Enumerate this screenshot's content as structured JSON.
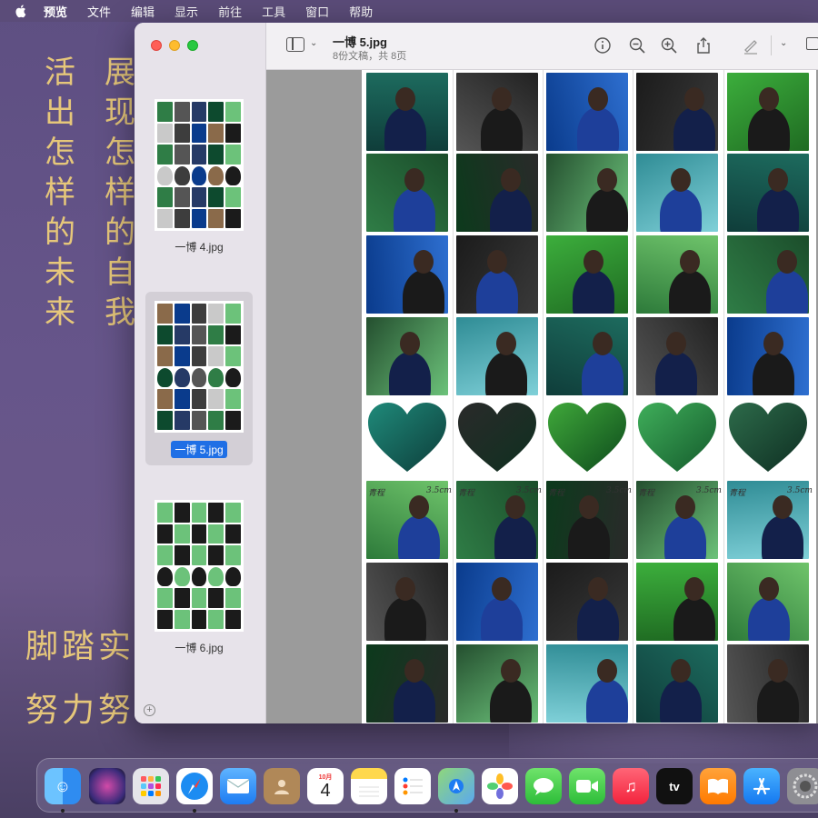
{
  "menubar": {
    "app_name": "预览",
    "items": [
      "文件",
      "编辑",
      "显示",
      "前往",
      "工具",
      "窗口",
      "帮助"
    ]
  },
  "wallpaper": {
    "col1": "活出怎样的未来",
    "col2": "展现怎样的自我",
    "line1": "脚踏实",
    "line2": "努力努"
  },
  "window": {
    "title": "一博 5.jpg",
    "subtitle": "8份文稿，共 8页",
    "thumbnails": [
      {
        "label": "一博 4.jpg",
        "selected": false
      },
      {
        "label": "一博 5.jpg",
        "selected": true
      },
      {
        "label": "一博 6.jpg",
        "selected": false
      }
    ],
    "toolbar_icons": [
      "sidebar-toggle-icon",
      "info-icon",
      "zoom-out-icon",
      "zoom-in-icon",
      "share-icon",
      "markup-icon"
    ]
  },
  "sheet": {
    "heart_caption_left": "青程",
    "heart_caption_right": "3.5cm"
  },
  "dock": {
    "calendar_month": "10月",
    "calendar_day": "4",
    "apps": [
      "Finder",
      "Siri",
      "Launchpad",
      "Safari",
      "Mail",
      "Contacts",
      "Calendar",
      "Notes",
      "Reminders",
      "Maps",
      "Photos",
      "Messages",
      "FaceTime",
      "Music",
      "TV",
      "Books",
      "App Store",
      "System Preferences"
    ]
  }
}
